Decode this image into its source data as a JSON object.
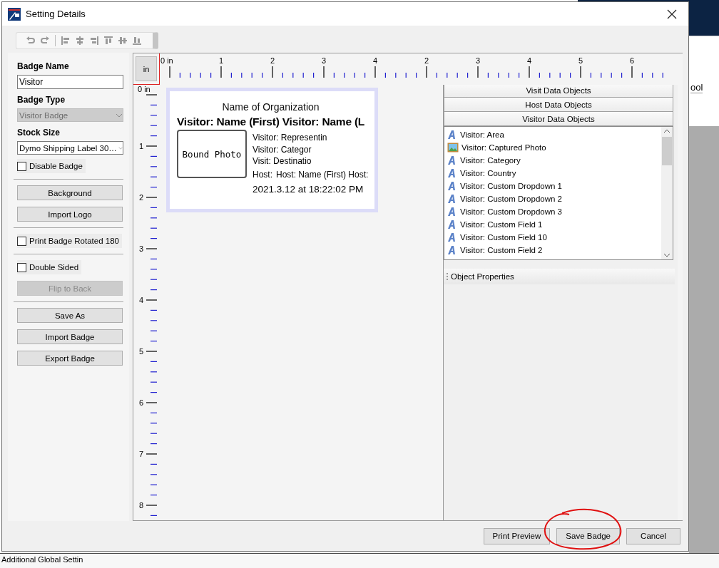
{
  "window": {
    "title": "Setting Details"
  },
  "left_panel": {
    "badge_name": {
      "label": "Badge Name",
      "value": "Visitor"
    },
    "badge_type": {
      "label": "Badge Type",
      "value": "Visitor Badge",
      "disabled": true
    },
    "stock_size": {
      "label": "Stock Size",
      "value": "Dymo Shipping Label 30…",
      "disabled": false
    },
    "groups": [
      [
        {
          "kind": "checkbox",
          "label": "Disable Badge",
          "checked": false
        }
      ],
      [
        {
          "kind": "button",
          "label": "Background",
          "disabled": false
        },
        {
          "kind": "button",
          "label": "Import Logo",
          "disabled": false
        }
      ],
      [
        {
          "kind": "checkbox",
          "label": "Print Badge Rotated 180",
          "checked": false
        }
      ],
      [
        {
          "kind": "checkbox",
          "label": "Double Sided",
          "checked": false
        },
        {
          "kind": "button",
          "label": "Flip to Back",
          "disabled": true
        }
      ],
      [
        {
          "kind": "button",
          "label": "Save As",
          "disabled": false
        },
        {
          "kind": "button",
          "label": "Import Badge",
          "disabled": false
        },
        {
          "kind": "button",
          "label": "Export Badge",
          "disabled": false
        }
      ]
    ]
  },
  "ruler": {
    "unit": "in",
    "x_labels": [
      "0 in",
      "1",
      "2",
      "3",
      "4",
      "2",
      "3",
      "4",
      "5",
      "6"
    ],
    "y_labels": [
      "0 in",
      "1",
      "2",
      "3",
      "4",
      "5",
      "6",
      "7",
      "8"
    ]
  },
  "badge": {
    "organization": "Name of Organization",
    "name_line": "Visitor: Name (First) Visitor: Name (L",
    "photo_label": "Bound Photo",
    "fields": [
      "Visitor: Representin",
      "Visitor: Categor",
      "Visit: Destinatio"
    ],
    "host_label": "Host:",
    "host_value": "Host: Name (First) Host:",
    "timestamp": "2021.3.12 at 18:22:02 PM"
  },
  "right_panel": {
    "sections": [
      "Visit Data Objects",
      "Host Data Objects",
      "Visitor Data Objects"
    ],
    "objects": [
      {
        "kind": "text",
        "label": "Visitor: Area"
      },
      {
        "kind": "photo",
        "label": "Visitor: Captured Photo"
      },
      {
        "kind": "text",
        "label": "Visitor: Category"
      },
      {
        "kind": "text",
        "label": "Visitor: Country"
      },
      {
        "kind": "text",
        "label": "Visitor: Custom Dropdown 1"
      },
      {
        "kind": "text",
        "label": "Visitor: Custom Dropdown 2"
      },
      {
        "kind": "text",
        "label": "Visitor: Custom Dropdown 3"
      },
      {
        "kind": "text",
        "label": "Visitor: Custom Field 1"
      },
      {
        "kind": "text",
        "label": "Visitor: Custom Field 10"
      },
      {
        "kind": "text",
        "label": "Visitor: Custom Field 2"
      }
    ],
    "properties_title": "Object Properties"
  },
  "footer": {
    "buttons": [
      "Print Preview",
      "Save Badge",
      "Cancel"
    ]
  },
  "background_app": {
    "right_text": "ool",
    "bottom_text": "Additional Global Settin"
  }
}
